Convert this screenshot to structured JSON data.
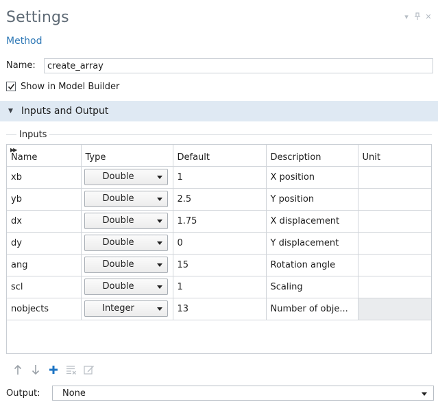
{
  "header": {
    "title": "Settings",
    "subtitle": "Method",
    "window_icons": [
      "chevron-down-icon",
      "pin-icon",
      "close-icon"
    ]
  },
  "name_field": {
    "label": "Name:",
    "value": "create_array"
  },
  "show_in_builder": {
    "label": "Show in Model Builder",
    "checked": true
  },
  "section": {
    "label": "Inputs and Output"
  },
  "inputs": {
    "group_label": "Inputs",
    "columns": [
      "Name",
      "Type",
      "Default",
      "Description",
      "Unit"
    ],
    "rows": [
      {
        "name": "xb",
        "type": "Double",
        "default": "1",
        "description": "X position",
        "unit": ""
      },
      {
        "name": "yb",
        "type": "Double",
        "default": "2.5",
        "description": "Y position",
        "unit": ""
      },
      {
        "name": "dx",
        "type": "Double",
        "default": "1.75",
        "description": "X displacement",
        "unit": ""
      },
      {
        "name": "dy",
        "type": "Double",
        "default": "0",
        "description": "Y displacement",
        "unit": ""
      },
      {
        "name": "ang",
        "type": "Double",
        "default": "15",
        "description": "Rotation angle",
        "unit": ""
      },
      {
        "name": "scl",
        "type": "Double",
        "default": "1",
        "description": "Scaling",
        "unit": ""
      },
      {
        "name": "nobjects",
        "type": "Integer",
        "default": "13",
        "description": "Number of obje...",
        "unit": ""
      }
    ]
  },
  "toolbar": {
    "icons": [
      "move-up-icon",
      "move-down-icon",
      "add-icon",
      "delete-list-icon",
      "edit-icon"
    ]
  },
  "output": {
    "label": "Output:",
    "value": "None"
  },
  "colors": {
    "accent": "#2e78b6",
    "section_bg": "#dfe9f3",
    "title": "#5e6a75",
    "add_icon": "#1c74c4"
  }
}
